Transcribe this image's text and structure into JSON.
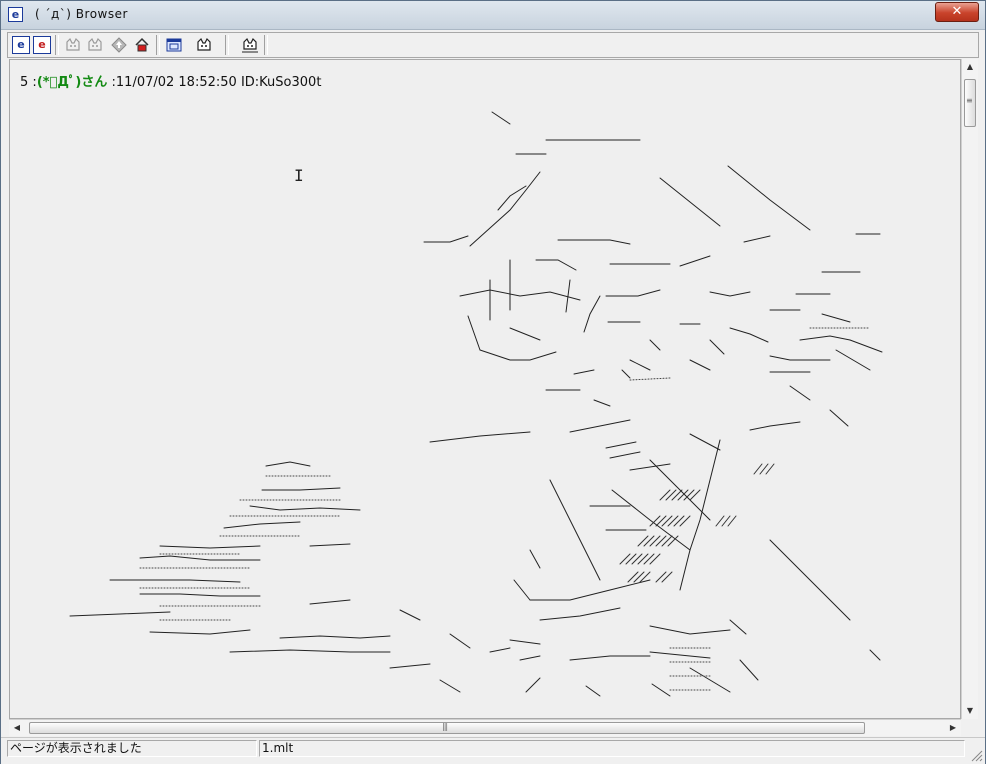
{
  "window": {
    "title": "( ´д`) Browser",
    "app_icon": "ie-icon",
    "close_label": "✕"
  },
  "toolbar": {
    "buttons": [
      {
        "name": "ie-icon",
        "label": "e"
      },
      {
        "name": "ie-red-icon",
        "label": "e"
      },
      {
        "name": "back-cat-icon",
        "label": ""
      },
      {
        "name": "forward-cat-icon",
        "label": ""
      },
      {
        "name": "up-icon",
        "label": ""
      },
      {
        "name": "home-icon",
        "label": ""
      },
      {
        "name": "window-icon",
        "label": ""
      },
      {
        "name": "cat-face-icon",
        "label": ""
      },
      {
        "name": "cat-settings-icon",
        "label": ""
      }
    ]
  },
  "post": {
    "number": "5",
    "separator": ":",
    "name": "(*ﾟДﾟ)さん",
    "date": ":11/07/02 18:52:50",
    "id": "ID:KuSo300t"
  },
  "status": {
    "message": "ページが表示されました",
    "file": "1.mlt"
  },
  "colors": {
    "name_green": "#138a13",
    "background": "#efefef"
  }
}
